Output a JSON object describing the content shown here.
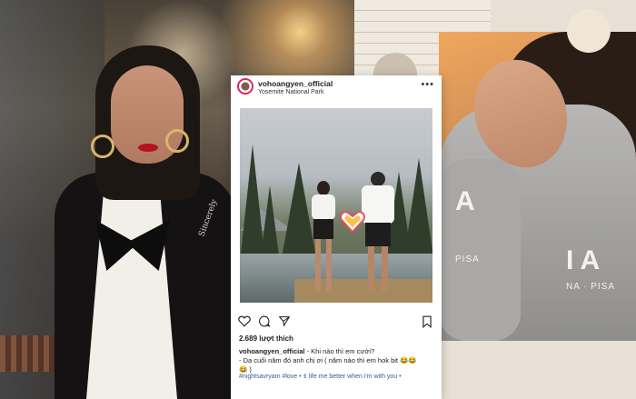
{
  "post": {
    "username": "vohoangyen_official",
    "location": "Yosemite National Park",
    "more_label": "•••",
    "likes": "2.689 lượt thích",
    "caption_user": "vohoangyen_official",
    "caption_line1": " - Khi nào thì em cưới?",
    "caption_line2": "- Dạ cuối năm đó anh chị ơi ( năm nào thì em hok bit 😂😂",
    "caption_line3": "😂 )",
    "hashtags": "#nightsavryam #love • 𝕿 life me better when i'm with you •"
  },
  "overlays": {
    "brooch_text": "Sincerely",
    "hoodie_letter_left": "A",
    "hoodie_letter_right": "I A",
    "hoodie_small_left": "PISA",
    "hoodie_small_right": "NA · PISA"
  },
  "colors": {
    "accent_heart_border": "#d6286c",
    "hashtag": "#3b5a9a",
    "lipstick": "#b3121e"
  },
  "icons": [
    "heart-icon",
    "comment-icon",
    "share-icon",
    "bookmark-icon",
    "more-icon"
  ]
}
